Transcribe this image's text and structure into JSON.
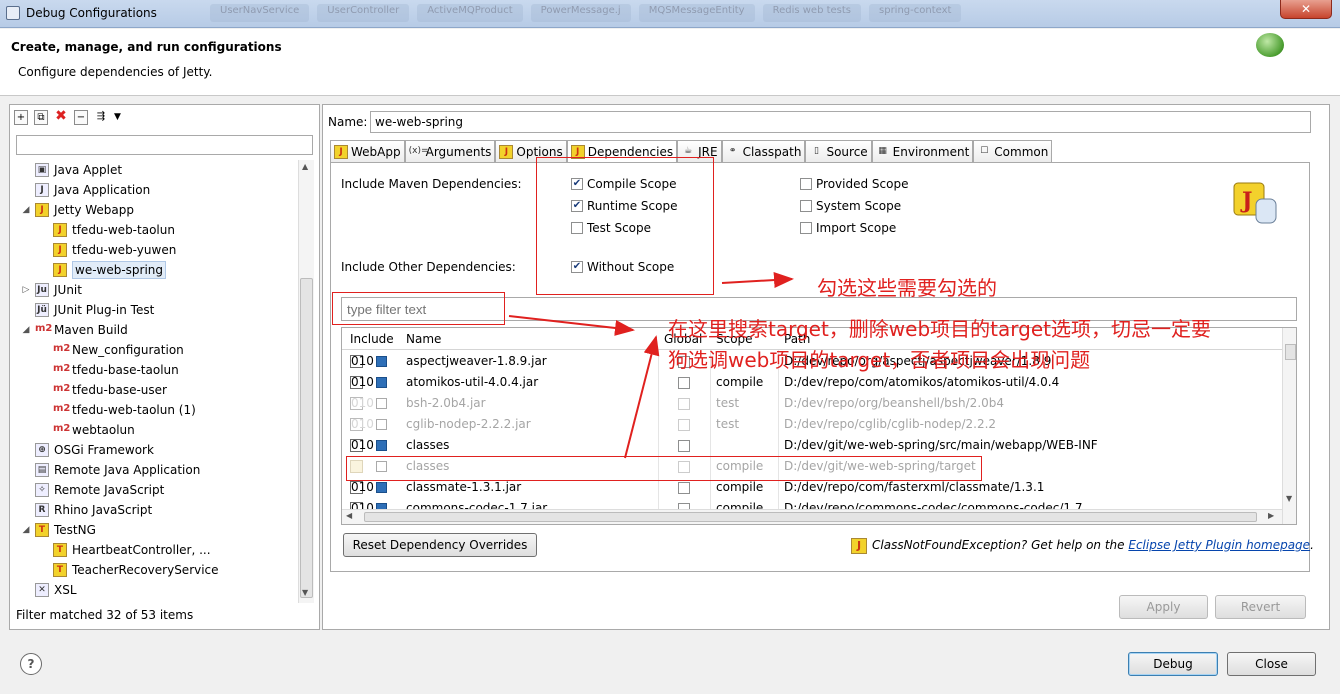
{
  "window": {
    "title": "Debug Configurations",
    "close_glyph": "✕",
    "background_tabs": [
      "UserNavService",
      "UserController",
      "ActiveMQProduct",
      "PowerMessage.j",
      "MQSMessageEntity",
      "Redis web tests",
      "spring-context"
    ]
  },
  "header": {
    "title": "Create, manage, and run configurations",
    "subtitle": "Configure dependencies of Jetty."
  },
  "left": {
    "filter_placeholder": "",
    "tree": [
      {
        "label": "Java Applet",
        "icon": "applet-icon",
        "level": 1,
        "twisty": ""
      },
      {
        "label": "Java Application",
        "icon": "java-app-icon",
        "level": 1,
        "twisty": ""
      },
      {
        "label": "Jetty Webapp",
        "icon": "jetty-icon",
        "level": 1,
        "twisty": "◢"
      },
      {
        "label": "tfedu-web-taolun",
        "icon": "jetty-icon",
        "level": 2,
        "twisty": ""
      },
      {
        "label": "tfedu-web-yuwen",
        "icon": "jetty-icon",
        "level": 2,
        "twisty": ""
      },
      {
        "label": "we-web-spring",
        "icon": "jetty-icon",
        "level": 2,
        "twisty": "",
        "selected": true
      },
      {
        "label": "JUnit",
        "icon": "junit-icon",
        "level": 1,
        "twisty": "▷"
      },
      {
        "label": "JUnit Plug-in Test",
        "icon": "junit-plugin-icon",
        "level": 1,
        "twisty": ""
      },
      {
        "label": "Maven Build",
        "icon": "maven-icon",
        "level": 1,
        "twisty": "◢"
      },
      {
        "label": "New_configuration",
        "icon": "maven-icon",
        "level": 2,
        "twisty": ""
      },
      {
        "label": "tfedu-base-taolun",
        "icon": "maven-icon",
        "level": 2,
        "twisty": ""
      },
      {
        "label": "tfedu-base-user",
        "icon": "maven-icon",
        "level": 2,
        "twisty": ""
      },
      {
        "label": "tfedu-web-taolun (1)",
        "icon": "maven-icon",
        "level": 2,
        "twisty": ""
      },
      {
        "label": "webtaolun",
        "icon": "maven-icon",
        "level": 2,
        "twisty": ""
      },
      {
        "label": "OSGi Framework",
        "icon": "osgi-icon",
        "level": 1,
        "twisty": ""
      },
      {
        "label": "Remote Java Application",
        "icon": "remote-java-icon",
        "level": 1,
        "twisty": ""
      },
      {
        "label": "Remote JavaScript",
        "icon": "remote-js-icon",
        "level": 1,
        "twisty": ""
      },
      {
        "label": "Rhino JavaScript",
        "icon": "rhino-icon",
        "level": 1,
        "twisty": ""
      },
      {
        "label": "TestNG",
        "icon": "testng-icon",
        "level": 1,
        "twisty": "◢"
      },
      {
        "label": "HeartbeatController, ...",
        "icon": "testng-icon",
        "level": 2,
        "twisty": ""
      },
      {
        "label": "TeacherRecoveryService",
        "icon": "testng-icon",
        "level": 2,
        "twisty": ""
      },
      {
        "label": "XSL",
        "icon": "xsl-icon",
        "level": 1,
        "twisty": ""
      }
    ],
    "filter_matched": "Filter matched 32 of 53 items"
  },
  "right": {
    "name_label": "Name:",
    "name_value": "we-web-spring",
    "tabs": [
      {
        "label": "WebApp",
        "icon": "jetty-icon",
        "glyph": "J",
        "active": false
      },
      {
        "label": "Arguments",
        "icon": "arguments-icon",
        "glyph": "(x)=",
        "active": false
      },
      {
        "label": "Options",
        "icon": "jetty-icon",
        "glyph": "J",
        "active": false
      },
      {
        "label": "Dependencies",
        "icon": "jetty-icon",
        "glyph": "J",
        "active": true
      },
      {
        "label": "JRE",
        "icon": "jre-icon",
        "glyph": "☕",
        "active": false
      },
      {
        "label": "Classpath",
        "icon": "classpath-icon",
        "glyph": "⚭",
        "active": false
      },
      {
        "label": "Source",
        "icon": "source-icon",
        "glyph": "▯",
        "active": false
      },
      {
        "label": "Environment",
        "icon": "environment-icon",
        "glyph": "▦",
        "active": false
      },
      {
        "label": "Common",
        "icon": "common-icon",
        "glyph": "☐",
        "active": false
      }
    ],
    "maven_label": "Include Maven Dependencies:",
    "other_label": "Include Other Dependencies:",
    "scopes": {
      "compile": {
        "label": "Compile Scope",
        "checked": true
      },
      "runtime": {
        "label": "Runtime Scope",
        "checked": true
      },
      "test": {
        "label": "Test Scope",
        "checked": false
      },
      "provided": {
        "label": "Provided Scope",
        "checked": false
      },
      "system": {
        "label": "System Scope",
        "checked": false
      },
      "import": {
        "label": "Import Scope",
        "checked": false
      },
      "without": {
        "label": "Without Scope",
        "checked": true
      }
    },
    "filter_placeholder": "type filter text",
    "columns": {
      "include": "Include",
      "name": "Name",
      "global": "Global",
      "scope": "Scope",
      "path": "Path"
    },
    "rows": [
      {
        "name": "aspectjweaver-1.8.9.jar",
        "scope": "",
        "path": "D:/dev/repo/org/aspectj/aspectjweaver/1.8.9",
        "global": false,
        "disabled": false,
        "icon": "jar-icon"
      },
      {
        "name": "atomikos-util-4.0.4.jar",
        "scope": "compile",
        "path": "D:/dev/repo/com/atomikos/atomikos-util/4.0.4",
        "global": false,
        "disabled": false,
        "icon": "jar-icon"
      },
      {
        "name": "bsh-2.0b4.jar",
        "scope": "test",
        "path": "D:/dev/repo/org/beanshell/bsh/2.0b4",
        "global": false,
        "disabled": true,
        "icon": "jar-icon"
      },
      {
        "name": "cglib-nodep-2.2.2.jar",
        "scope": "test",
        "path": "D:/dev/repo/cglib/cglib-nodep/2.2.2",
        "global": false,
        "disabled": true,
        "icon": "jar-icon"
      },
      {
        "name": "classes",
        "scope": "",
        "path": "D:/dev/git/we-web-spring/src/main/webapp/WEB-INF",
        "global": false,
        "disabled": false,
        "icon": "jar-icon"
      },
      {
        "name": "classes",
        "scope": "compile",
        "path": "D:/dev/git/we-web-spring/target",
        "global": false,
        "disabled": true,
        "icon": "folder-icon"
      },
      {
        "name": "classmate-1.3.1.jar",
        "scope": "compile",
        "path": "D:/dev/repo/com/fasterxml/classmate/1.3.1",
        "global": false,
        "disabled": false,
        "icon": "jar-icon"
      },
      {
        "name": "commons-codec-1.7.jar",
        "scope": "compile",
        "path": "D:/dev/repo/commons-codec/commons-codec/1.7",
        "global": false,
        "disabled": false,
        "icon": "jar-icon"
      }
    ],
    "reset_button": "Reset Dependency Overrides",
    "help_text": "ClassNotFoundException? Get help on the",
    "help_link": "Eclipse Jetty Plugin homepage",
    "help_period": ".",
    "apply_button": "Apply",
    "revert_button": "Revert"
  },
  "annotations": {
    "note1": "勾选这些需要勾选的",
    "note2_line1": "在这里搜索target，删除web项目的target选项，切忌一定要",
    "note2_line2": "狗选调web项目的target，否者项目会出现问题",
    "color": "#e0211f"
  },
  "footer": {
    "help_glyph": "?",
    "debug_button": "Debug",
    "close_button": "Close"
  }
}
